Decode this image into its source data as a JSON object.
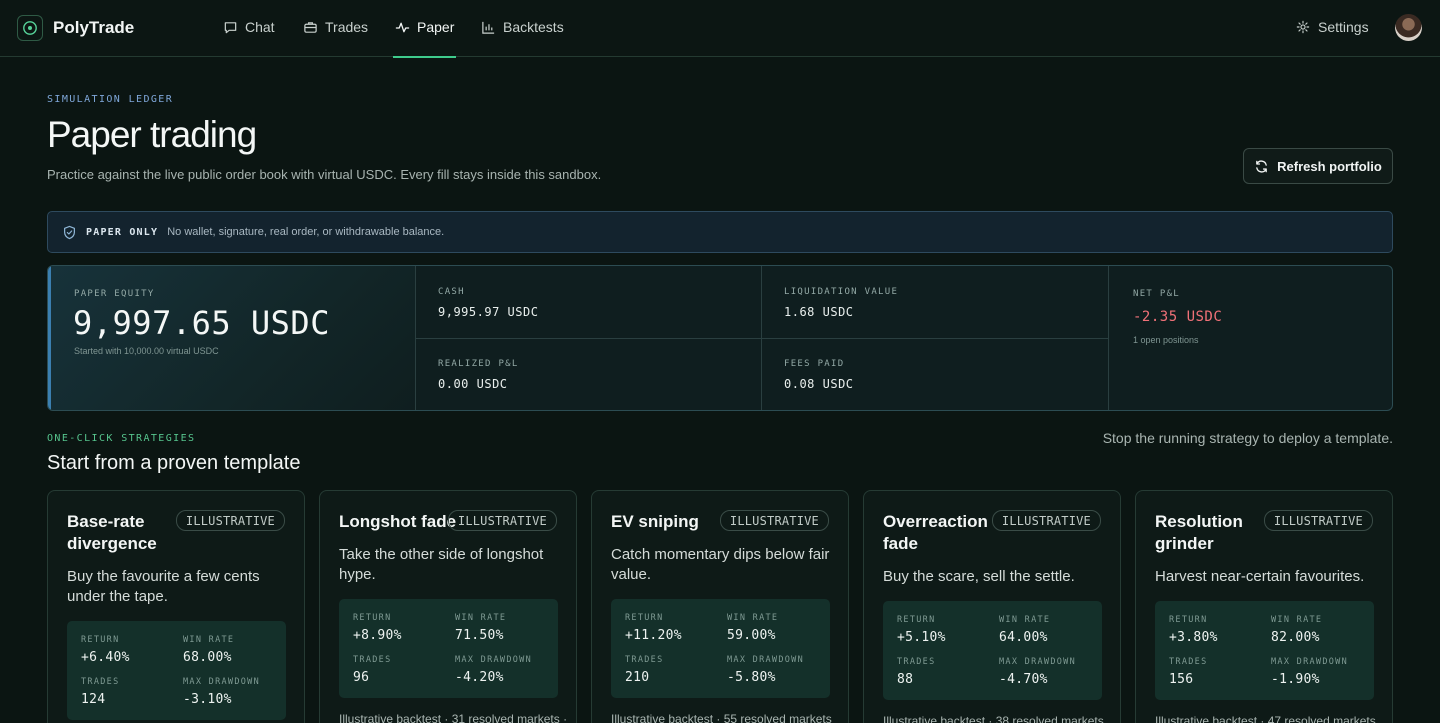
{
  "app": {
    "brand": "PolyTrade",
    "nav": [
      {
        "label": "Chat",
        "icon": "chat-icon"
      },
      {
        "label": "Trades",
        "icon": "briefcase-icon"
      },
      {
        "label": "Paper",
        "icon": "activity-icon",
        "active": true
      },
      {
        "label": "Backtests",
        "icon": "bar-chart-icon"
      }
    ],
    "settings_label": "Settings"
  },
  "header": {
    "eyebrow": "SIMULATION LEDGER",
    "title": "Paper trading",
    "subtitle": "Practice against the live public order book with virtual USDC. Every fill stays inside this sandbox.",
    "refresh_label": "Refresh portfolio"
  },
  "banner": {
    "tag": "PAPER ONLY",
    "text": "No wallet, signature, real order, or withdrawable balance."
  },
  "stats": {
    "equity_label": "PAPER EQUITY",
    "equity_value": "9,997.65 USDC",
    "equity_note": "Started with 10,000.00 virtual USDC",
    "cash_label": "CASH",
    "cash_value": "9,995.97 USDC",
    "liquidation_label": "LIQUIDATION VALUE",
    "liquidation_value": "1.68 USDC",
    "net_label": "NET P&L",
    "net_value": "-2.35 USDC",
    "net_note": "1 open positions",
    "realized_label": "REALIZED P&L",
    "realized_value": "0.00 USDC",
    "fees_label": "FEES PAID",
    "fees_value": "0.08 USDC"
  },
  "strategies": {
    "eyebrow": "ONE-CLICK STRATEGIES",
    "title": "Start from a proven template",
    "note": "Stop the running strategy to deploy a template.",
    "metric_labels": {
      "return": "RETURN",
      "win_rate": "WIN RATE",
      "trades": "TRADES",
      "max_drawdown": "MAX DRAWDOWN"
    },
    "cards": [
      {
        "title": "Base-rate divergence",
        "badge": "ILLUSTRATIVE",
        "desc": "Buy the favourite a few cents under the tape.",
        "return": "+6.40%",
        "win_rate": "68.00%",
        "trades": "124",
        "max_drawdown": "-3.10%",
        "foot": ""
      },
      {
        "title": "Longshot fade",
        "badge": "ILLUSTRATIVE",
        "desc": "Take the other side of longshot hype.",
        "return": "+8.90%",
        "win_rate": "71.50%",
        "trades": "96",
        "max_drawdown": "-4.20%",
        "foot": "Illustrative backtest · 31 resolved markets ·"
      },
      {
        "title": "EV sniping",
        "badge": "ILLUSTRATIVE",
        "desc": "Catch momentary dips below fair value.",
        "return": "+11.20%",
        "win_rate": "59.00%",
        "trades": "210",
        "max_drawdown": "-5.80%",
        "foot": "Illustrative backtest · 55 resolved markets"
      },
      {
        "title": "Overreaction fade",
        "badge": "ILLUSTRATIVE",
        "desc": "Buy the scare, sell the settle.",
        "return": "+5.10%",
        "win_rate": "64.00%",
        "trades": "88",
        "max_drawdown": "-4.70%",
        "foot": "Illustrative backtest · 38 resolved markets"
      },
      {
        "title": "Resolution grinder",
        "badge": "ILLUSTRATIVE",
        "desc": "Harvest near-certain favourites.",
        "return": "+3.80%",
        "win_rate": "82.00%",
        "trades": "156",
        "max_drawdown": "-1.90%",
        "foot": "Illustrative backtest · 47 resolved markets"
      }
    ]
  },
  "colors": {
    "accent": "#3fcb8c",
    "negative": "#f07178",
    "info": "#7fa7d9"
  }
}
